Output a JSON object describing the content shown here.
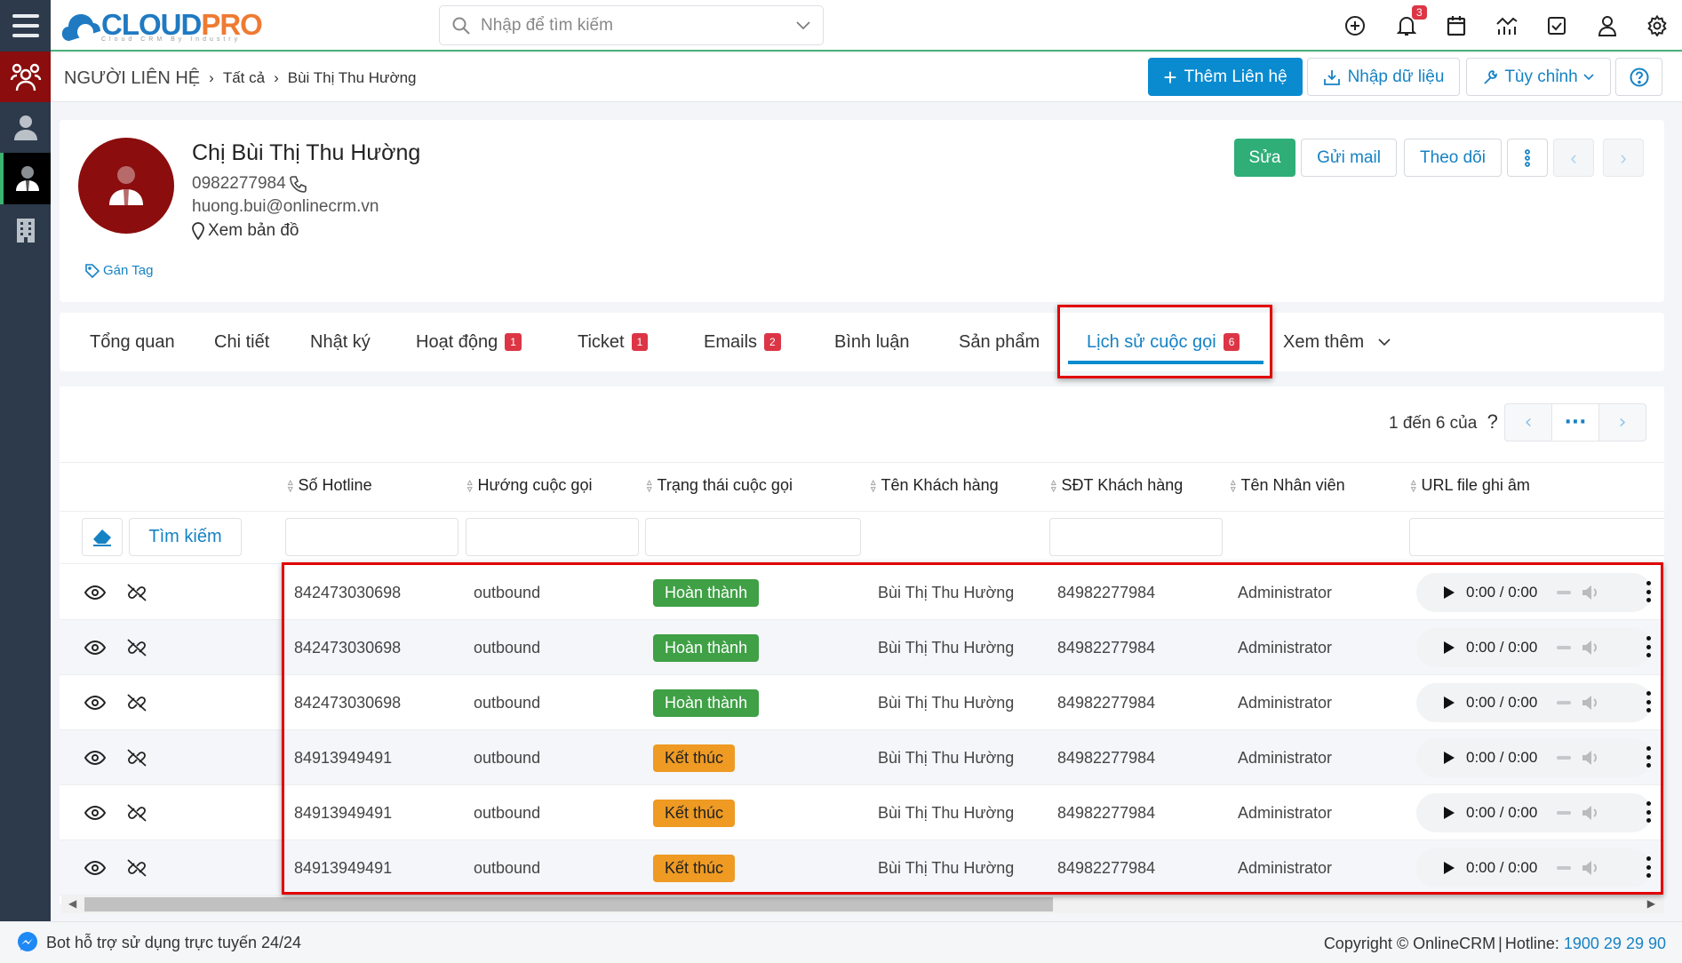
{
  "app": {
    "logo_main": "CLOUD",
    "logo_accent": "PRO",
    "logo_sub": "Cloud CRM By Industry"
  },
  "search": {
    "placeholder": "Nhập để tìm kiếm"
  },
  "topbar": {
    "notification_count": "3"
  },
  "breadcrumb": {
    "root": "NGƯỜI LIÊN HỆ",
    "level1": "Tất cả",
    "level2": "Bùi Thị Thu Hường"
  },
  "toolbar": {
    "add_label": "Thêm Liên hệ",
    "import_label": "Nhập dữ liệu",
    "customize_label": "Tùy chỉnh"
  },
  "profile": {
    "name": "Chị Bùi Thị Thu Hường",
    "phone": "0982277984",
    "email": "huong.bui@onlinecrm.vn",
    "map_label": "Xem bản đồ",
    "tag_label": "Gán Tag",
    "edit_label": "Sửa",
    "mail_label": "Gửi mail",
    "follow_label": "Theo dõi"
  },
  "tabs": [
    {
      "label": "Tổng quan"
    },
    {
      "label": "Chi tiết"
    },
    {
      "label": "Nhật ký"
    },
    {
      "label": "Hoạt động",
      "badge": "1"
    },
    {
      "label": "Ticket",
      "badge": "1"
    },
    {
      "label": "Emails",
      "badge": "2"
    },
    {
      "label": "Bình luận"
    },
    {
      "label": "Sản phẩm"
    },
    {
      "label": "Lịch sử cuộc gọi",
      "badge": "6",
      "active": true
    },
    {
      "label": "Xem thêm"
    }
  ],
  "pager": {
    "text": "1 đến 6 của",
    "total": "?",
    "more": "···"
  },
  "table": {
    "search_button": "Tìm kiếm",
    "columns": [
      "Số Hotline",
      "Hướng cuộc gọi",
      "Trạng thái cuộc gọi",
      "Tên Khách hàng",
      "SĐT Khách hàng",
      "Tên Nhân viên",
      "URL file ghi âm"
    ],
    "rows": [
      {
        "hotline": "842473030698",
        "direction": "outbound",
        "status": "Hoàn thành",
        "status_type": "done",
        "customer": "Bùi Thị Thu Hường",
        "customer_phone": "84982277984",
        "staff": "Administrator",
        "audio_time": "0:00 / 0:00"
      },
      {
        "hotline": "842473030698",
        "direction": "outbound",
        "status": "Hoàn thành",
        "status_type": "done",
        "customer": "Bùi Thị Thu Hường",
        "customer_phone": "84982277984",
        "staff": "Administrator",
        "audio_time": "0:00 / 0:00"
      },
      {
        "hotline": "842473030698",
        "direction": "outbound",
        "status": "Hoàn thành",
        "status_type": "done",
        "customer": "Bùi Thị Thu Hường",
        "customer_phone": "84982277984",
        "staff": "Administrator",
        "audio_time": "0:00 / 0:00"
      },
      {
        "hotline": "84913949491",
        "direction": "outbound",
        "status": "Kết thúc",
        "status_type": "end",
        "customer": "Bùi Thị Thu Hường",
        "customer_phone": "84982277984",
        "staff": "Administrator",
        "audio_time": "0:00 / 0:00"
      },
      {
        "hotline": "84913949491",
        "direction": "outbound",
        "status": "Kết thúc",
        "status_type": "end",
        "customer": "Bùi Thị Thu Hường",
        "customer_phone": "84982277984",
        "staff": "Administrator",
        "audio_time": "0:00 / 0:00"
      },
      {
        "hotline": "84913949491",
        "direction": "outbound",
        "status": "Kết thúc",
        "status_type": "end",
        "customer": "Bùi Thị Thu Hường",
        "customer_phone": "84982277984",
        "staff": "Administrator",
        "audio_time": "0:00 / 0:00"
      }
    ]
  },
  "footer": {
    "bot_text": "Bot hỗ trợ sử dụng trực tuyến 24/24",
    "copyright": "Copyright © OnlineCRM",
    "hotline_label": "Hotline:",
    "hotline": "1900 29 29 90"
  },
  "colors": {
    "primary": "#0a8bd0",
    "success": "#3fa046",
    "warning": "#ee9a23",
    "danger": "#dc3545",
    "brand_red": "#8b0d0d",
    "highlight": "#e10000"
  }
}
